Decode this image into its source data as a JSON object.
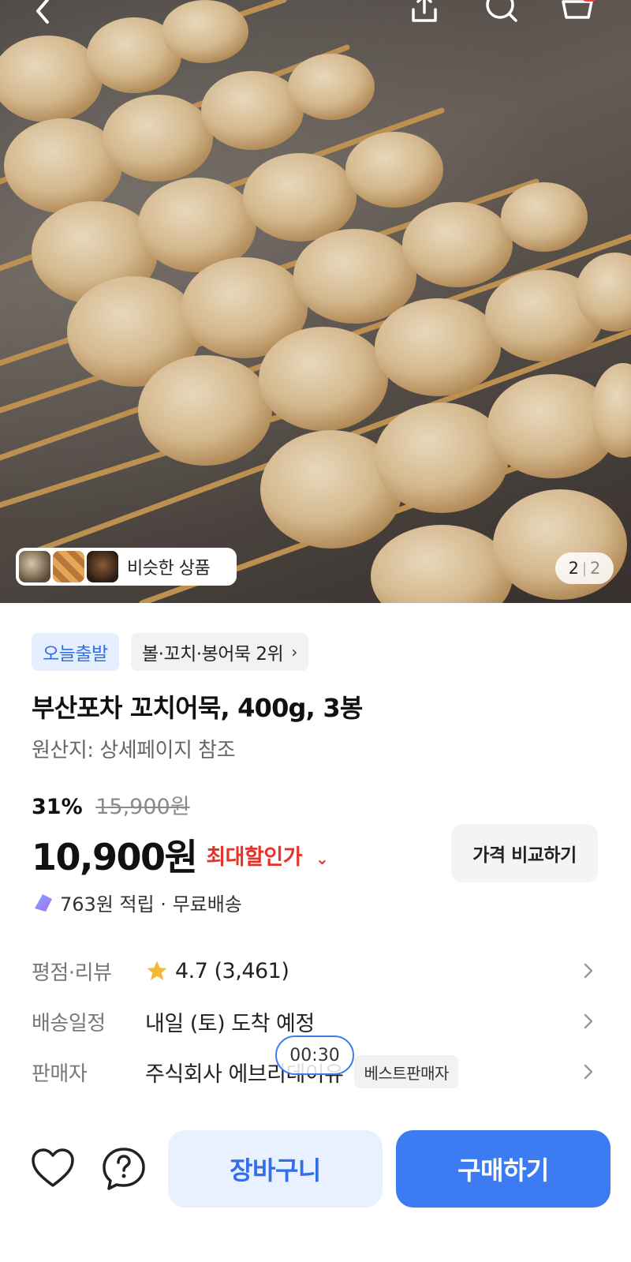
{
  "hero": {
    "similar_label": "비슷한 상품",
    "page_current": "2",
    "page_total": "2",
    "icons": [
      "back-arrow-icon",
      "share-icon",
      "search-icon",
      "cart-icon"
    ]
  },
  "tags": {
    "today_ship": "오늘출발",
    "rank": "볼·꼬치·봉어묵 2위",
    "rank_chevron": "›"
  },
  "product": {
    "title": "부산포차 꼬치어묵, 400g, 3봉",
    "origin": "원산지: 상세페이지 참조"
  },
  "pricing": {
    "discount_pct": "31%",
    "original_price": "15,900원",
    "price": "10,900원",
    "max_discount": "최대할인가",
    "max_discount_chevron": "⌄",
    "compare_label": "가격 비교하기",
    "points_text": "763원 적립 · 무료배송"
  },
  "info": {
    "rating_label": "평점·리뷰",
    "rating_value": "4.7 (3,461)",
    "delivery_label": "배송일정",
    "delivery_value": "내일 (토) 도착 예정",
    "seller_label": "판매자",
    "seller_value": "주식회사 에브리데이유",
    "seller_badge": "베스트판매자",
    "timer": "00:30"
  },
  "actions": {
    "cart_label": "장바구니",
    "buy_label": "구매하기"
  },
  "colors": {
    "accent": "#3d7bf2",
    "accent_light": "#e9f0ff",
    "discount_red": "#e5332a",
    "star": "#f5b836"
  }
}
